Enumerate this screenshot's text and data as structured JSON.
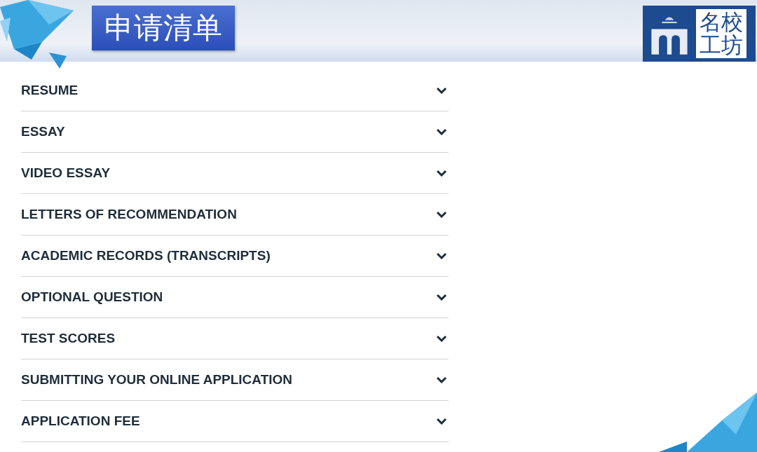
{
  "header": {
    "title": "申请清单",
    "logo": {
      "lines": [
        "名校",
        "工坊"
      ]
    }
  },
  "accordion": {
    "items": [
      {
        "label": "RESUME",
        "expanded": false
      },
      {
        "label": "ESSAY",
        "expanded": false
      },
      {
        "label": "VIDEO ESSAY",
        "expanded": false
      },
      {
        "label": "LETTERS OF RECOMMENDATION",
        "expanded": false
      },
      {
        "label": "ACADEMIC RECORDS (TRANSCRIPTS)",
        "expanded": false
      },
      {
        "label": "OPTIONAL QUESTION",
        "expanded": false
      },
      {
        "label": "TEST SCORES",
        "expanded": false
      },
      {
        "label": "SUBMITTING YOUR ONLINE APPLICATION",
        "expanded": false
      },
      {
        "label": "APPLICATION FEE",
        "expanded": false
      }
    ]
  }
}
